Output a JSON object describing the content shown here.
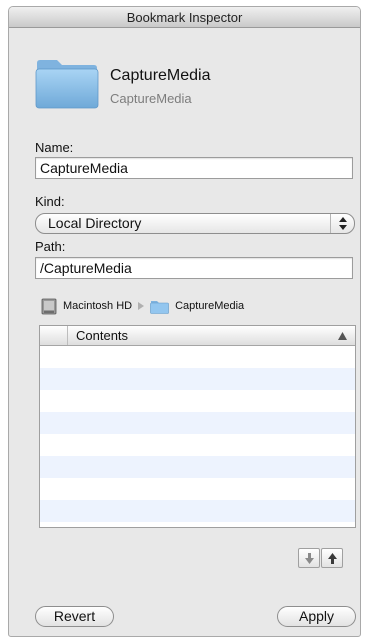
{
  "window": {
    "title": "Bookmark Inspector"
  },
  "bookmark": {
    "title": "CaptureMedia",
    "subtitle": "CaptureMedia"
  },
  "form": {
    "name_label": "Name:",
    "name_value": "CaptureMedia",
    "kind_label": "Kind:",
    "kind_value": "Local Directory",
    "path_label": "Path:",
    "path_value": "/CaptureMedia"
  },
  "path_control": {
    "items": [
      {
        "label": "Macintosh HD",
        "icon": "hard-drive-icon"
      },
      {
        "label": "CaptureMedia",
        "icon": "folder-icon"
      }
    ]
  },
  "table": {
    "header": "Contents",
    "sort_icon": "sort-ascending-icon",
    "rows": []
  },
  "buttons": {
    "move_down_icon": "arrow-down-icon",
    "move_up_icon": "arrow-up-icon",
    "revert_label": "Revert",
    "apply_label": "Apply"
  },
  "colors": {
    "folder": "#8ec3ec",
    "row_alternate": "#edf3fe",
    "window_bg": "#e8e8e8"
  }
}
